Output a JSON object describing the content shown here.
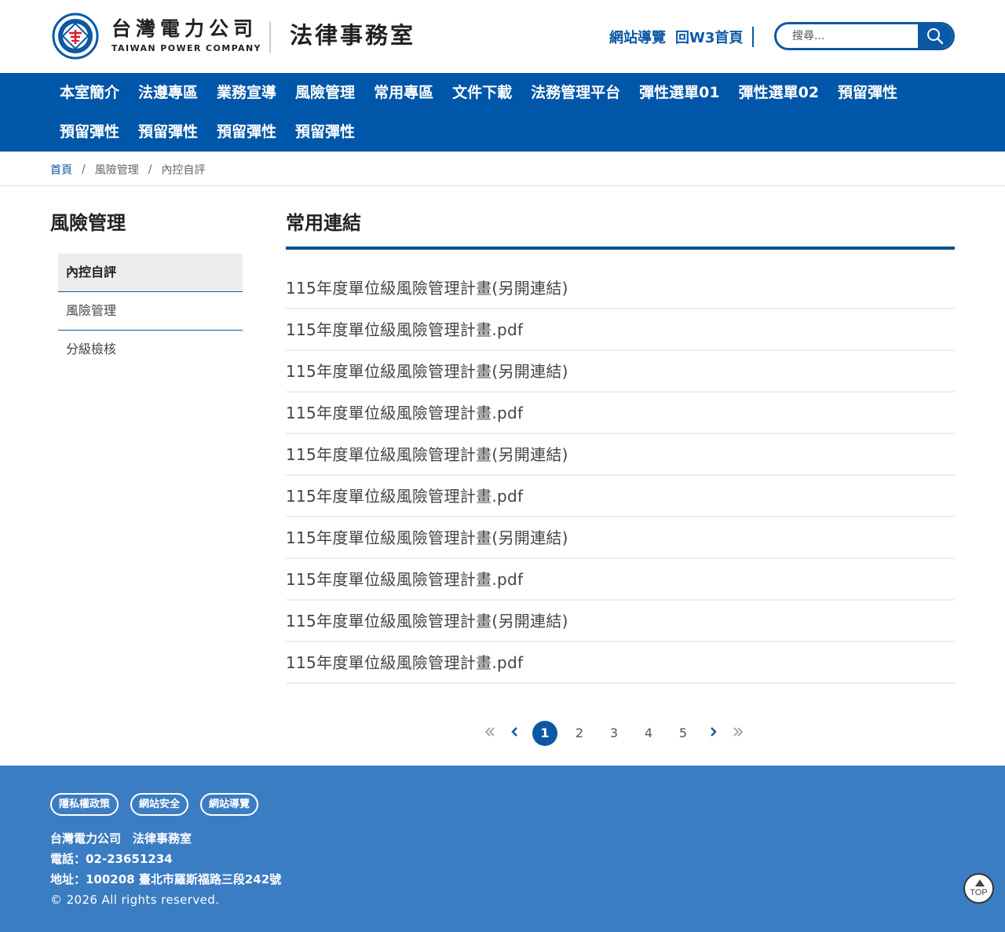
{
  "header": {
    "brand_zh": "台灣電力公司",
    "brand_en": "TAIWAN POWER COMPANY",
    "site_name": "法律事務室",
    "top_links": [
      "網站導覽",
      "回W3首頁"
    ],
    "search_placeholder": "搜尋..."
  },
  "nav": {
    "row1": [
      "本室簡介",
      "法遵專區",
      "業務宣導",
      "風險管理",
      "常用專區",
      "文件下載",
      "法務管理平台",
      "彈性選單01",
      "彈性選單02",
      "預留彈性"
    ],
    "row2": [
      "預留彈性",
      "預留彈性",
      "預留彈性",
      "預留彈性"
    ]
  },
  "breadcrumb": {
    "home": "首頁",
    "items": [
      "風險管理",
      "內控自評"
    ],
    "separator": "/"
  },
  "sidebar": {
    "title": "風險管理",
    "items": [
      "內控自評",
      "風險管理",
      "分級檢核"
    ],
    "active_index": 0
  },
  "main": {
    "title": "常用連結",
    "links": [
      "115年度單位級風險管理計畫(另開連結)",
      "115年度單位級風險管理計畫.pdf",
      "115年度單位級風險管理計畫(另開連結)",
      "115年度單位級風險管理計畫.pdf",
      "115年度單位級風險管理計畫(另開連結)",
      "115年度單位級風險管理計畫.pdf",
      "115年度單位級風險管理計畫(另開連結)",
      "115年度單位級風險管理計畫.pdf",
      "115年度單位級風險管理計畫(另開連結)",
      "115年度單位級風險管理計畫.pdf"
    ]
  },
  "pagination": {
    "first": "«",
    "prev": "‹",
    "pages": [
      "1",
      "2",
      "3",
      "4",
      "5"
    ],
    "current": "1",
    "next": "›",
    "last": "»"
  },
  "footer": {
    "buttons": [
      "隱私權政策",
      "網站安全",
      "網站導覽"
    ],
    "org": "台灣電力公司　法律事務室",
    "phone": "電話：02-23651234",
    "address": "地址：100208 臺北市羅斯福路三段242號",
    "copyright": "© 2026 All rights reserved.",
    "top_label": "TOP"
  },
  "colors": {
    "brand_blue": "#0b59a5",
    "nav_blue": "#0056a8",
    "footer_blue": "#3b7dc2"
  }
}
